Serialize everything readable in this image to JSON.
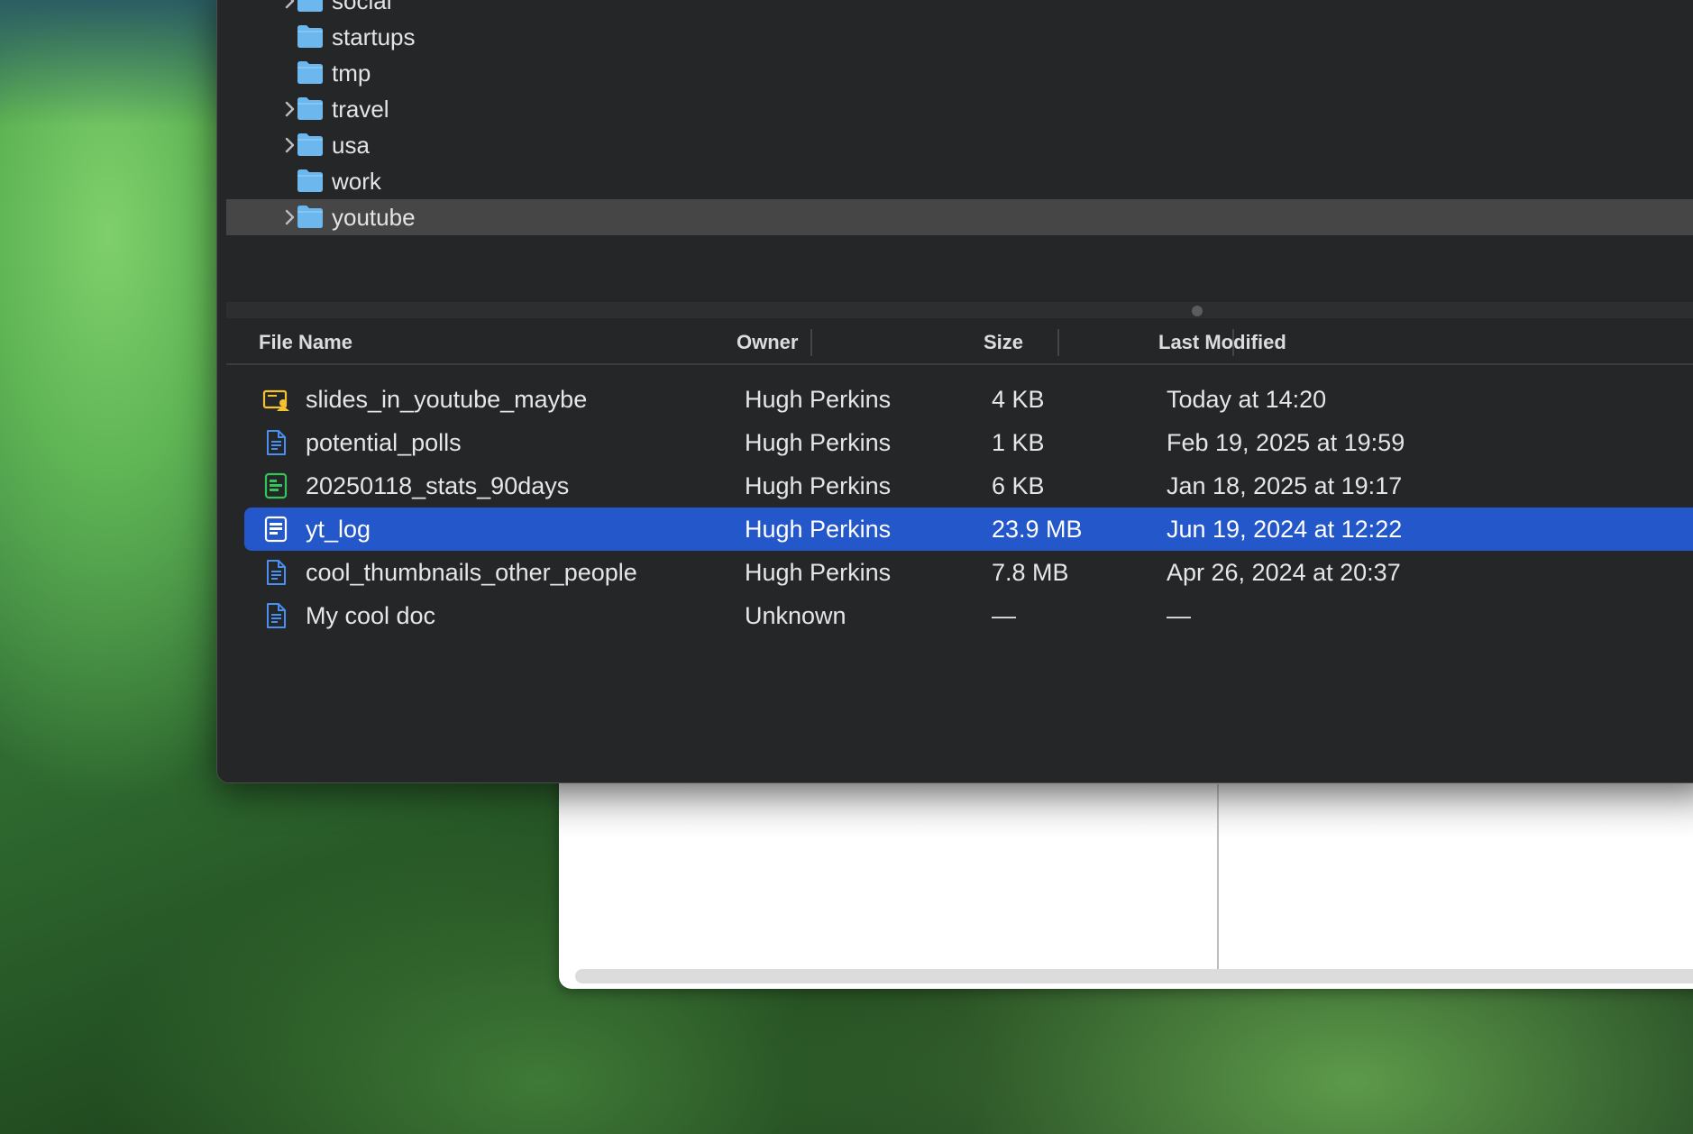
{
  "folders": [
    {
      "name": "social",
      "expandable": true,
      "selected": false
    },
    {
      "name": "startups",
      "expandable": false,
      "selected": false
    },
    {
      "name": "tmp",
      "expandable": false,
      "selected": false
    },
    {
      "name": "travel",
      "expandable": true,
      "selected": false
    },
    {
      "name": "usa",
      "expandable": true,
      "selected": false
    },
    {
      "name": "work",
      "expandable": false,
      "selected": false
    },
    {
      "name": "youtube",
      "expandable": true,
      "selected": true
    }
  ],
  "columns": {
    "name": "File Name",
    "owner": "Owner",
    "size": "Size",
    "modified": "Last Modified"
  },
  "files": [
    {
      "name": "slides_in_youtube_maybe",
      "owner": "Hugh Perkins",
      "size": "4 KB",
      "modified": "Today at 14:20",
      "icon": "slides-icon",
      "selected": false
    },
    {
      "name": "potential_polls",
      "owner": "Hugh Perkins",
      "size": "1 KB",
      "modified": "Feb 19, 2025 at 19:59",
      "icon": "doc-icon",
      "selected": false
    },
    {
      "name": "20250118_stats_90days",
      "owner": "Hugh Perkins",
      "size": "6 KB",
      "modified": "Jan 18, 2025 at 19:17",
      "icon": "sheet-icon",
      "selected": false
    },
    {
      "name": "yt_log",
      "owner": "Hugh Perkins",
      "size": "23.9 MB",
      "modified": "Jun 19, 2024 at 12:22",
      "icon": "doc-filled-icon",
      "selected": true
    },
    {
      "name": "cool_thumbnails_other_people",
      "owner": "Hugh Perkins",
      "size": "7.8 MB",
      "modified": "Apr 26, 2024 at 20:37",
      "icon": "doc-icon",
      "selected": false
    },
    {
      "name": "My cool doc",
      "owner": "Unknown",
      "size": "—",
      "modified": "—",
      "icon": "doc-icon",
      "selected": false
    }
  ],
  "colors": {
    "window_bg": "#242628",
    "selection": "#2457c9",
    "folder_blue": "#6cb8ee",
    "doc_blue": "#4a8ff2",
    "sheet_green": "#35c45a",
    "slides_yellow": "#f2c232"
  }
}
